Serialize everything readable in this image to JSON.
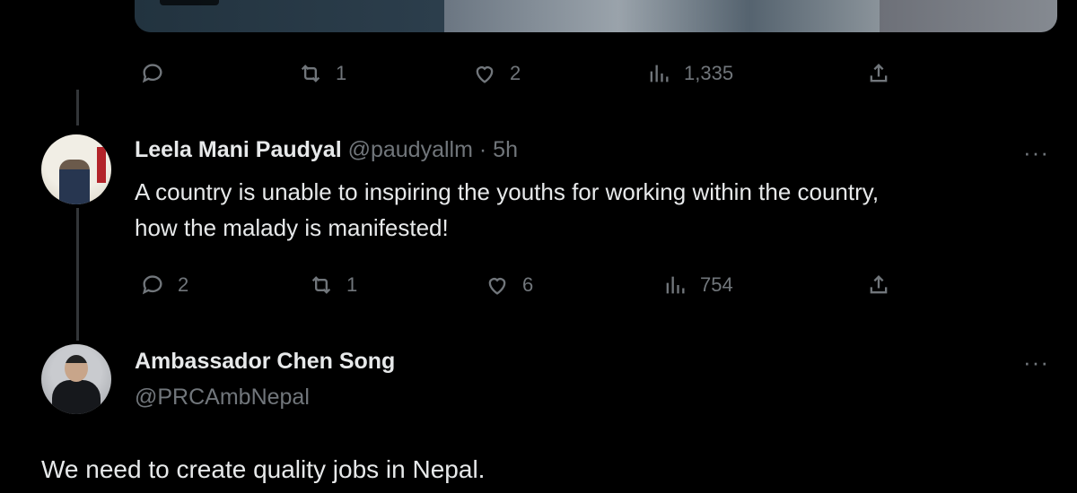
{
  "tweet1": {
    "actions": {
      "reply": "",
      "retweet": "1",
      "like": "2",
      "views": "1,335"
    }
  },
  "tweet2": {
    "name": "Leela Mani Paudyal",
    "handle": "@paudyallm",
    "sep": "·",
    "time": "5h",
    "more": "···",
    "text_line1": "A country is unable to inspiring the youths for working within the country,",
    "text_line2": "how the malady is manifested!",
    "actions": {
      "reply": "2",
      "retweet": "1",
      "like": "6",
      "views": "754"
    }
  },
  "tweet3": {
    "name": "Ambassador Chen Song",
    "handle": "@PRCAmbNepal",
    "more": "···",
    "text": "We need to create quality jobs in Nepal."
  },
  "icons": [
    "reply-icon",
    "retweet-icon",
    "like-icon",
    "views-icon",
    "share-icon",
    "more-icon"
  ],
  "colors": {
    "background": "#000000",
    "text": "#e7e9ea",
    "muted": "#71767b"
  }
}
